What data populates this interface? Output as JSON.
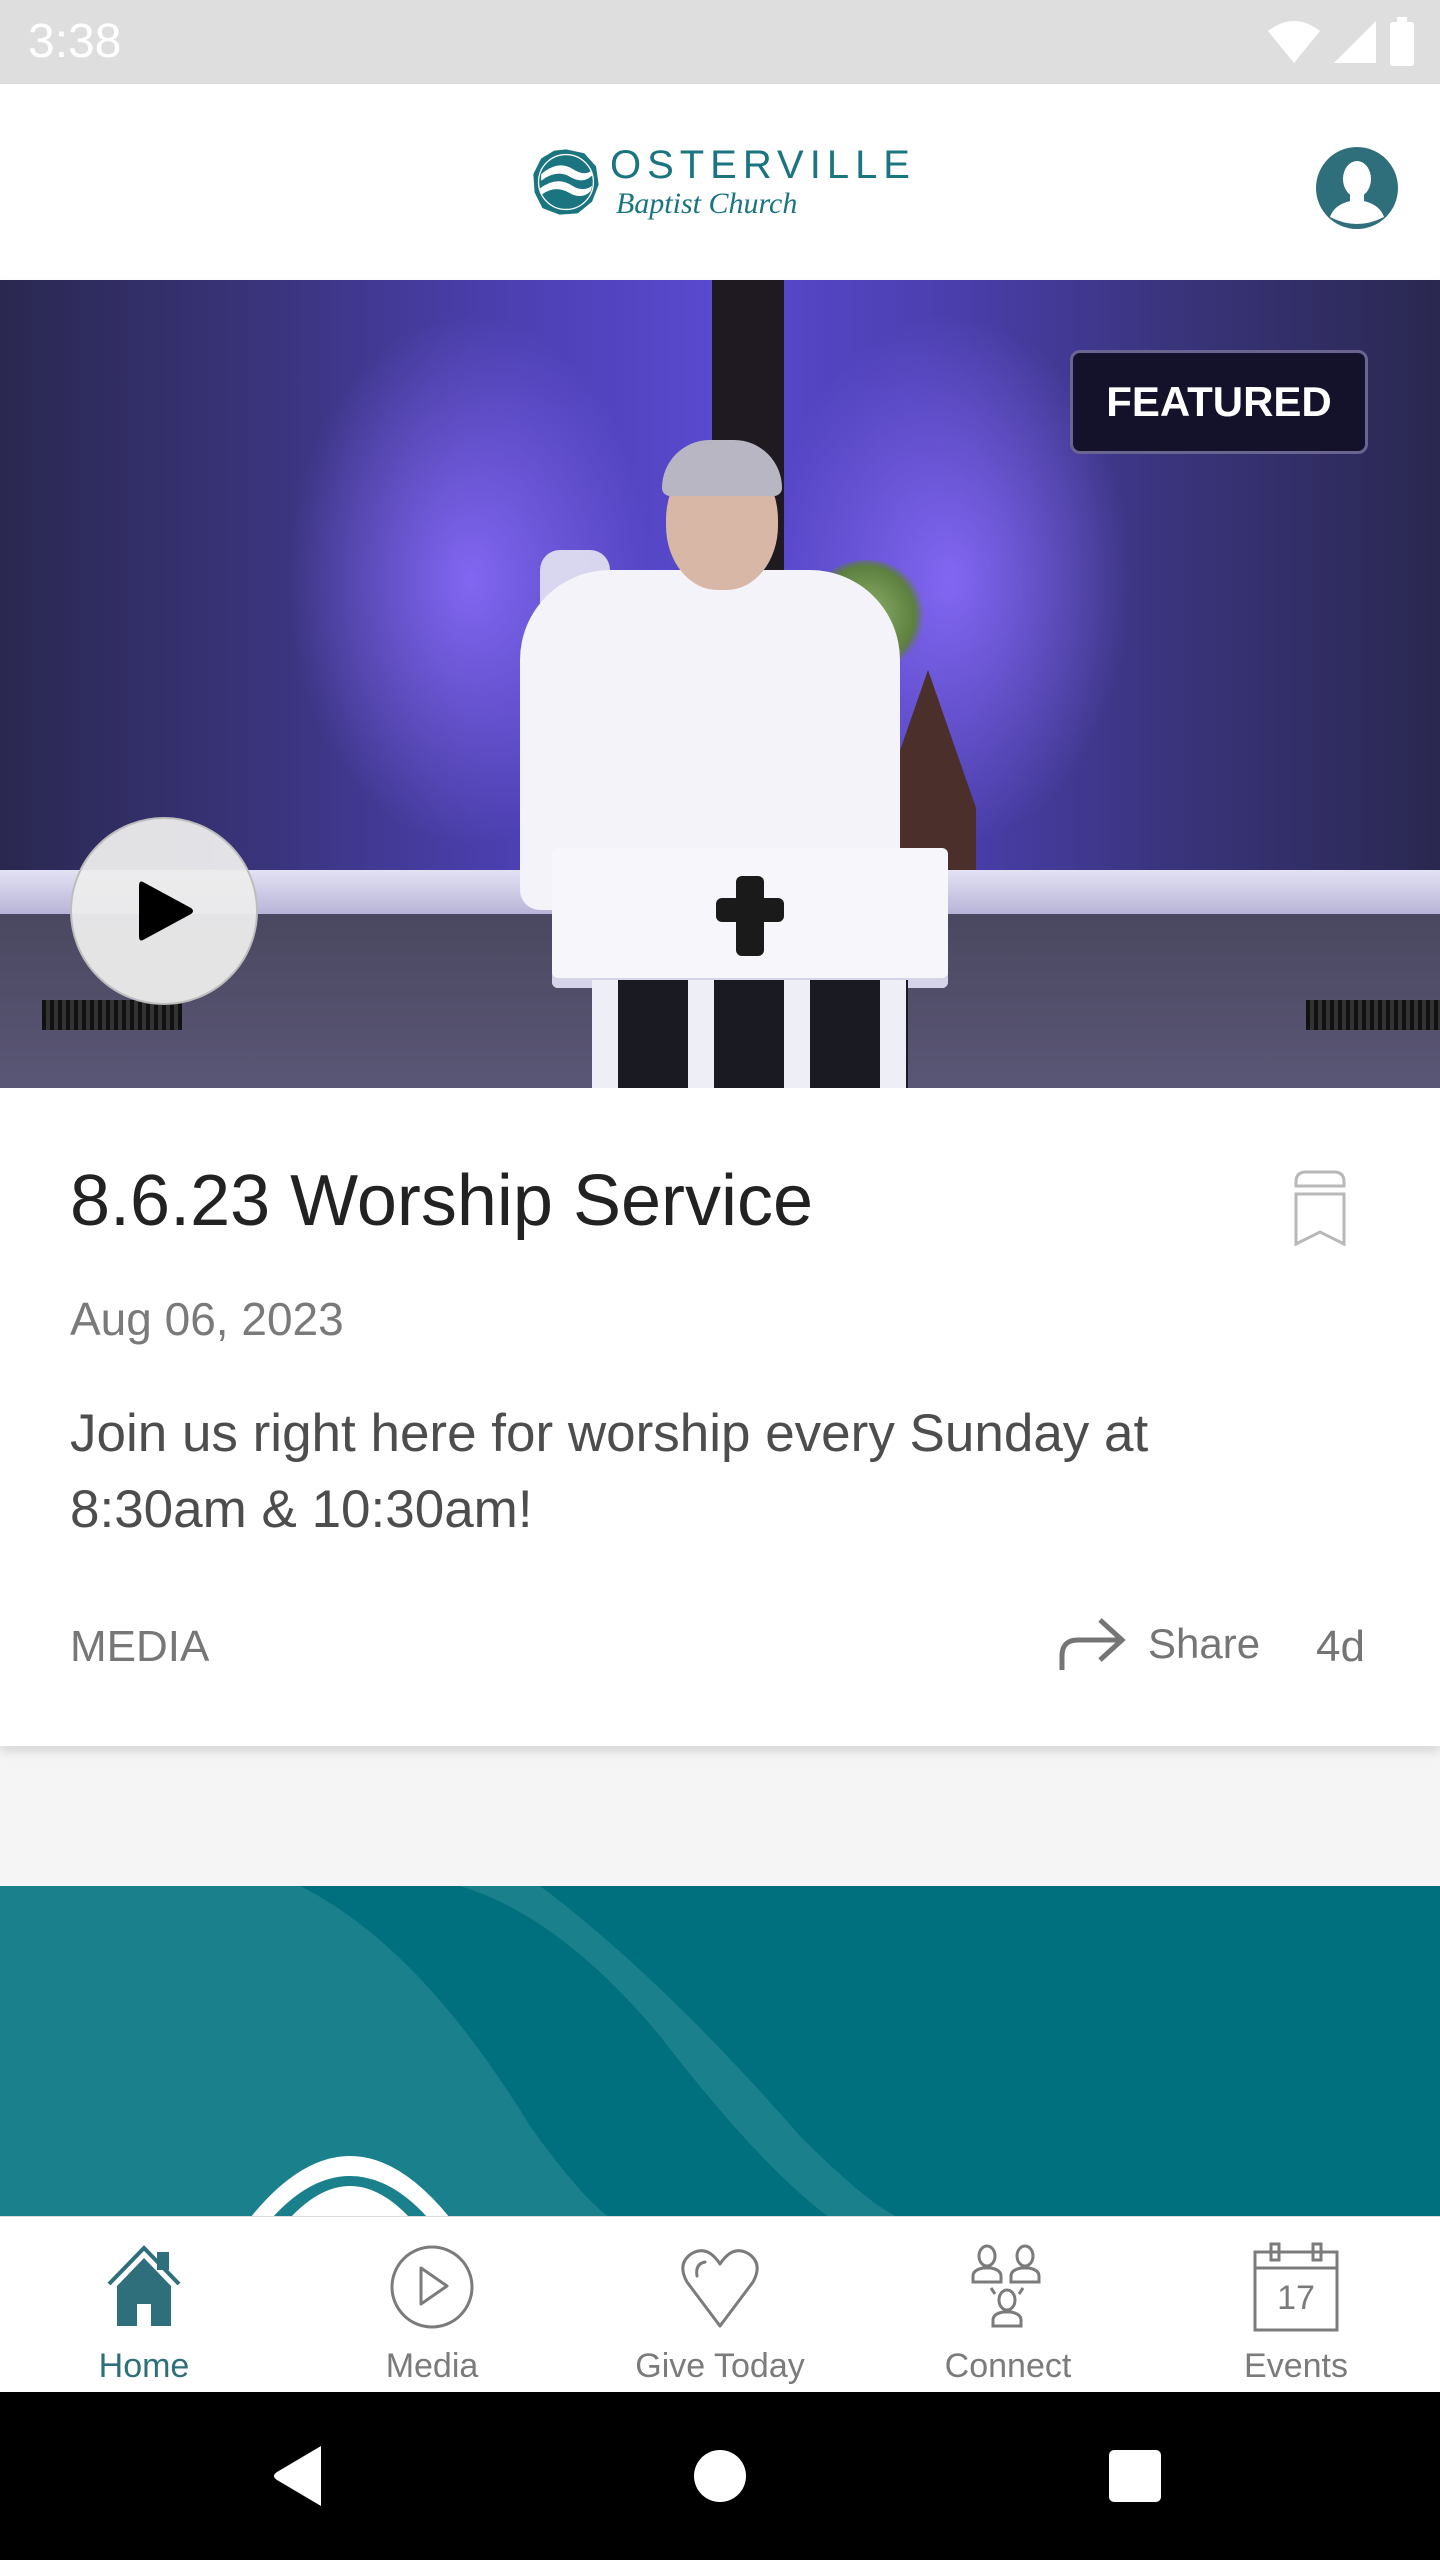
{
  "status_bar": {
    "time": "3:38",
    "icons": [
      "wifi-icon",
      "signal-icon",
      "battery-icon"
    ]
  },
  "header": {
    "logo_title": "OSTERVILLE",
    "logo_subtitle": "Baptist Church",
    "profile_icon": "user-profile-icon",
    "accent_color": "#1a7580"
  },
  "featured_card": {
    "badge": "FEATURED",
    "play_icon": "play-icon",
    "title": "8.6.23 Worship Service",
    "date": "Aug 06, 2023",
    "description": "Join us right here for worship every Sunday at 8:30am & 10:30am!",
    "category": "MEDIA",
    "share_label": "Share",
    "age": "4d",
    "bookmark_icon": "bookmark-icon"
  },
  "banner": {
    "color": "#00707f"
  },
  "bottom_nav": {
    "active_color": "#2f6f7c",
    "items": [
      {
        "label": "Home",
        "icon": "home-icon",
        "active": true
      },
      {
        "label": "Media",
        "icon": "play-circle-icon",
        "active": false
      },
      {
        "label": "Give Today",
        "icon": "heart-icon",
        "active": false
      },
      {
        "label": "Connect",
        "icon": "people-icon",
        "active": false
      },
      {
        "label": "Events",
        "icon": "calendar-icon",
        "active": false,
        "calendar_day": "17"
      }
    ]
  },
  "system_nav": {
    "buttons": [
      "back-icon",
      "home-circle-icon",
      "recents-icon"
    ]
  }
}
